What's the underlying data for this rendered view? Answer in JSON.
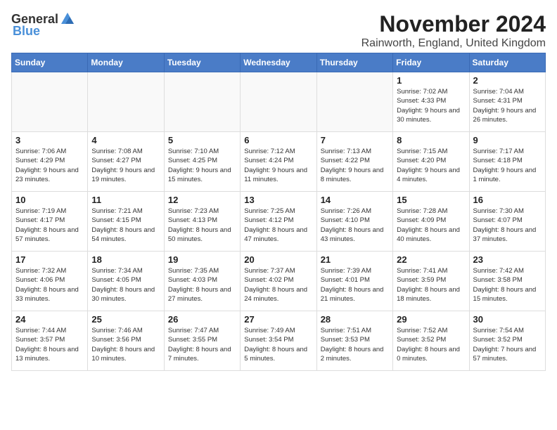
{
  "logo": {
    "general": "General",
    "blue": "Blue"
  },
  "title": "November 2024",
  "location": "Rainworth, England, United Kingdom",
  "days_header": [
    "Sunday",
    "Monday",
    "Tuesday",
    "Wednesday",
    "Thursday",
    "Friday",
    "Saturday"
  ],
  "weeks": [
    [
      {
        "day": "",
        "info": ""
      },
      {
        "day": "",
        "info": ""
      },
      {
        "day": "",
        "info": ""
      },
      {
        "day": "",
        "info": ""
      },
      {
        "day": "",
        "info": ""
      },
      {
        "day": "1",
        "info": "Sunrise: 7:02 AM\nSunset: 4:33 PM\nDaylight: 9 hours and 30 minutes."
      },
      {
        "day": "2",
        "info": "Sunrise: 7:04 AM\nSunset: 4:31 PM\nDaylight: 9 hours and 26 minutes."
      }
    ],
    [
      {
        "day": "3",
        "info": "Sunrise: 7:06 AM\nSunset: 4:29 PM\nDaylight: 9 hours and 23 minutes."
      },
      {
        "day": "4",
        "info": "Sunrise: 7:08 AM\nSunset: 4:27 PM\nDaylight: 9 hours and 19 minutes."
      },
      {
        "day": "5",
        "info": "Sunrise: 7:10 AM\nSunset: 4:25 PM\nDaylight: 9 hours and 15 minutes."
      },
      {
        "day": "6",
        "info": "Sunrise: 7:12 AM\nSunset: 4:24 PM\nDaylight: 9 hours and 11 minutes."
      },
      {
        "day": "7",
        "info": "Sunrise: 7:13 AM\nSunset: 4:22 PM\nDaylight: 9 hours and 8 minutes."
      },
      {
        "day": "8",
        "info": "Sunrise: 7:15 AM\nSunset: 4:20 PM\nDaylight: 9 hours and 4 minutes."
      },
      {
        "day": "9",
        "info": "Sunrise: 7:17 AM\nSunset: 4:18 PM\nDaylight: 9 hours and 1 minute."
      }
    ],
    [
      {
        "day": "10",
        "info": "Sunrise: 7:19 AM\nSunset: 4:17 PM\nDaylight: 8 hours and 57 minutes."
      },
      {
        "day": "11",
        "info": "Sunrise: 7:21 AM\nSunset: 4:15 PM\nDaylight: 8 hours and 54 minutes."
      },
      {
        "day": "12",
        "info": "Sunrise: 7:23 AM\nSunset: 4:13 PM\nDaylight: 8 hours and 50 minutes."
      },
      {
        "day": "13",
        "info": "Sunrise: 7:25 AM\nSunset: 4:12 PM\nDaylight: 8 hours and 47 minutes."
      },
      {
        "day": "14",
        "info": "Sunrise: 7:26 AM\nSunset: 4:10 PM\nDaylight: 8 hours and 43 minutes."
      },
      {
        "day": "15",
        "info": "Sunrise: 7:28 AM\nSunset: 4:09 PM\nDaylight: 8 hours and 40 minutes."
      },
      {
        "day": "16",
        "info": "Sunrise: 7:30 AM\nSunset: 4:07 PM\nDaylight: 8 hours and 37 minutes."
      }
    ],
    [
      {
        "day": "17",
        "info": "Sunrise: 7:32 AM\nSunset: 4:06 PM\nDaylight: 8 hours and 33 minutes."
      },
      {
        "day": "18",
        "info": "Sunrise: 7:34 AM\nSunset: 4:05 PM\nDaylight: 8 hours and 30 minutes."
      },
      {
        "day": "19",
        "info": "Sunrise: 7:35 AM\nSunset: 4:03 PM\nDaylight: 8 hours and 27 minutes."
      },
      {
        "day": "20",
        "info": "Sunrise: 7:37 AM\nSunset: 4:02 PM\nDaylight: 8 hours and 24 minutes."
      },
      {
        "day": "21",
        "info": "Sunrise: 7:39 AM\nSunset: 4:01 PM\nDaylight: 8 hours and 21 minutes."
      },
      {
        "day": "22",
        "info": "Sunrise: 7:41 AM\nSunset: 3:59 PM\nDaylight: 8 hours and 18 minutes."
      },
      {
        "day": "23",
        "info": "Sunrise: 7:42 AM\nSunset: 3:58 PM\nDaylight: 8 hours and 15 minutes."
      }
    ],
    [
      {
        "day": "24",
        "info": "Sunrise: 7:44 AM\nSunset: 3:57 PM\nDaylight: 8 hours and 13 minutes."
      },
      {
        "day": "25",
        "info": "Sunrise: 7:46 AM\nSunset: 3:56 PM\nDaylight: 8 hours and 10 minutes."
      },
      {
        "day": "26",
        "info": "Sunrise: 7:47 AM\nSunset: 3:55 PM\nDaylight: 8 hours and 7 minutes."
      },
      {
        "day": "27",
        "info": "Sunrise: 7:49 AM\nSunset: 3:54 PM\nDaylight: 8 hours and 5 minutes."
      },
      {
        "day": "28",
        "info": "Sunrise: 7:51 AM\nSunset: 3:53 PM\nDaylight: 8 hours and 2 minutes."
      },
      {
        "day": "29",
        "info": "Sunrise: 7:52 AM\nSunset: 3:52 PM\nDaylight: 8 hours and 0 minutes."
      },
      {
        "day": "30",
        "info": "Sunrise: 7:54 AM\nSunset: 3:52 PM\nDaylight: 7 hours and 57 minutes."
      }
    ]
  ]
}
